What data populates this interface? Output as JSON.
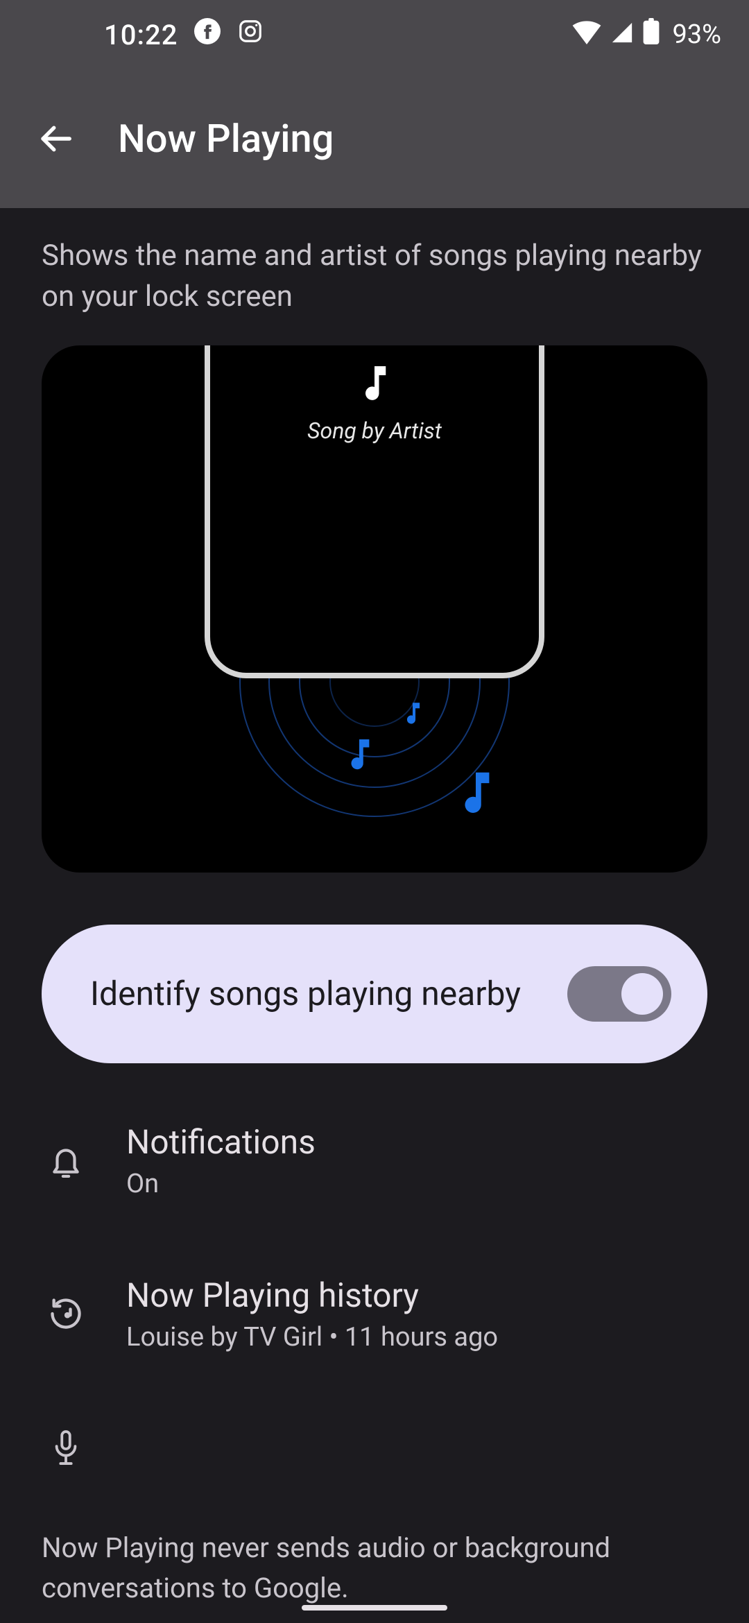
{
  "status": {
    "time": "10:22",
    "battery": "93%"
  },
  "header": {
    "title": "Now Playing"
  },
  "description": "Shows the name and artist of songs playing nearby on your lock screen",
  "illustration": {
    "caption": "Song by Artist"
  },
  "toggle": {
    "label": "Identify songs playing nearby",
    "enabled": true
  },
  "rows": {
    "notifications": {
      "title": "Notifications",
      "sub": "On"
    },
    "history": {
      "title": "Now Playing history",
      "sub": "Louise by TV Girl • 11 hours ago"
    }
  },
  "footer": "Now Playing never sends audio or background conversations to Google."
}
